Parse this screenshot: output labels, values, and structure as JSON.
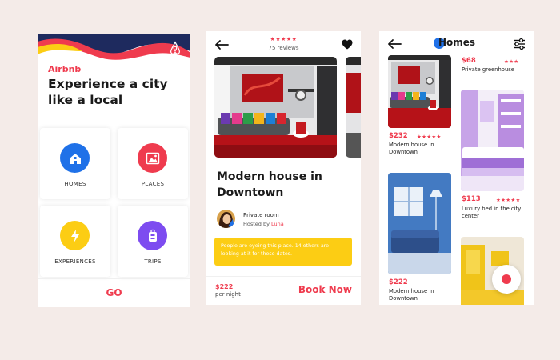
{
  "phone1": {
    "brand": "Airbnb",
    "headline": "Experience a city like a local",
    "categories": [
      {
        "label": "HOMES",
        "icon": "home-icon",
        "color": "#1f71e8"
      },
      {
        "label": "PLACES",
        "icon": "mountain-icon",
        "color": "#ef3b4e"
      },
      {
        "label": "EXPERIENCES",
        "icon": "lightning-icon",
        "color": "#fccd14"
      },
      {
        "label": "TRIPS",
        "icon": "luggage-icon",
        "color": "#7d4cf0"
      }
    ],
    "go_label": "GO"
  },
  "phone2": {
    "stars": "★★★★★",
    "reviews": "75 reviews",
    "title": "Modern house in Downtown",
    "room_type": "Private room",
    "hosted_by_prefix": "Hosted by",
    "host_name": "Luna",
    "banner_text": "People are eyeing this place. 14 others are looking at it for these dates.",
    "price": "$222",
    "price_unit": "per night",
    "book_label": "Book Now"
  },
  "phone3": {
    "title": "Homes",
    "listings": [
      {
        "price": "$232",
        "stars": "★★★★★",
        "name": "Modern house in Downtown"
      },
      {
        "price": "$68",
        "stars": "★★★",
        "name": "Private greenhouse"
      },
      {
        "price": "$113",
        "stars": "★★★★★",
        "name": "Luxury bed in the city center"
      },
      {
        "price": "$222",
        "stars": "",
        "name": "Modern house in Downtown"
      }
    ]
  },
  "colors": {
    "accent": "#ef3b4e",
    "blue": "#1f71e8",
    "yellow": "#fccd14",
    "purple": "#7d4cf0",
    "background": "#f4ebe8"
  }
}
